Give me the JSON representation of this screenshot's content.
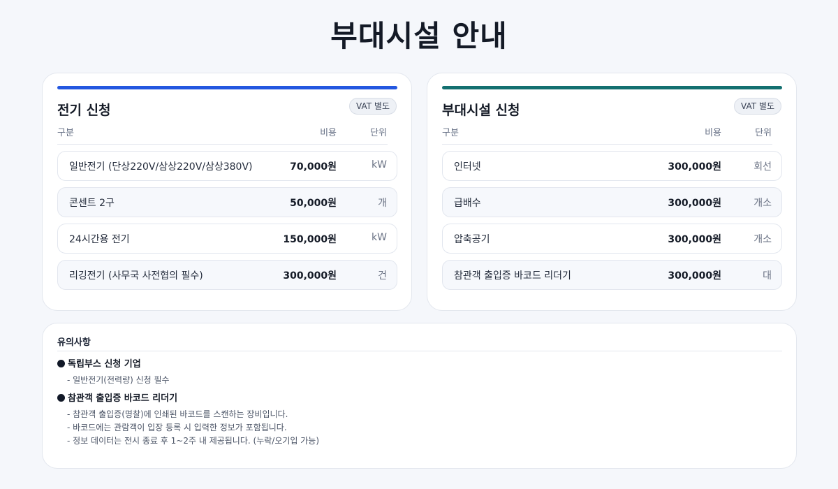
{
  "page": {
    "title": "부대시설 안내"
  },
  "electric": {
    "title": "전기 신청",
    "vat": "VAT 별도",
    "headers": {
      "category": "구분",
      "cost": "비용",
      "unit": "단위"
    },
    "rows": [
      {
        "name": "일반전기 (단상220V/삼상220V/삼상380V)",
        "cost": "70,000원",
        "unit": "kW"
      },
      {
        "name": "콘센트 2구",
        "cost": "50,000원",
        "unit": "개"
      },
      {
        "name": "24시간용 전기",
        "cost": "150,000원",
        "unit": "kW"
      },
      {
        "name": "리깅전기 (사무국 사전협의 필수)",
        "cost": "300,000원",
        "unit": "건"
      }
    ],
    "accent": "#2357e0"
  },
  "facility": {
    "title": "부대시설 신청",
    "vat": "VAT 별도",
    "headers": {
      "category": "구분",
      "cost": "비용",
      "unit": "단위"
    },
    "rows": [
      {
        "name": "인터넷",
        "cost": "300,000원",
        "unit": "회선"
      },
      {
        "name": "급배수",
        "cost": "300,000원",
        "unit": "개소"
      },
      {
        "name": "압축공기",
        "cost": "300,000원",
        "unit": "개소"
      },
      {
        "name": "참관객 출입증 바코드 리더기",
        "cost": "300,000원",
        "unit": "대"
      }
    ],
    "accent": "#137070"
  },
  "notes": {
    "title": "유의사항",
    "groups": [
      {
        "heading": "독립부스 신청 기업",
        "lines": [
          "- 일반전기(전력량) 신청 필수"
        ]
      },
      {
        "heading": "참관객 출입증 바코드 리더기",
        "lines": [
          "- 참관객 출입증(명찰)에 인쇄된 바코드를 스캔하는 장비입니다.",
          "- 바코드에는 관람객이 입장 등록 시 입력한 정보가 포함됩니다.",
          "- 정보 데이터는 전시 종료 후 1~2주 내 제공됩니다. (누락/오기입 가능)"
        ]
      }
    ]
  }
}
